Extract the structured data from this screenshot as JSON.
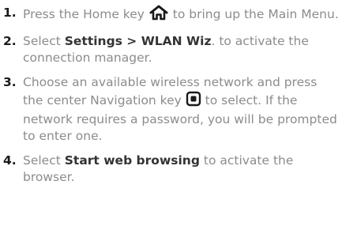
{
  "steps": [
    {
      "number": "1.",
      "text_before": "Press the Home key ",
      "icon": "home-icon",
      "text_after": " to bring up the Main Menu."
    },
    {
      "number": "2.",
      "text_before": "Select ",
      "strong": "Settings > WLAN Wiz",
      "text_after": ". to activate the connection manager."
    },
    {
      "number": "3.",
      "text_before": "Choose an available wireless network and press the center Navigation key ",
      "icon": "center-navigation-key-icon",
      "text_after": " to select. If the network requires a password, you will be prompted to enter one."
    },
    {
      "number": "4.",
      "text_before": "Select ",
      "strong": "Start web browsing",
      "text_after": " to activate the browser."
    }
  ],
  "colors": {
    "body_text": "#8c8c8c",
    "strong_text": "#333333",
    "number_text": "#1a1a1a",
    "icon": "#1a1a1a"
  }
}
